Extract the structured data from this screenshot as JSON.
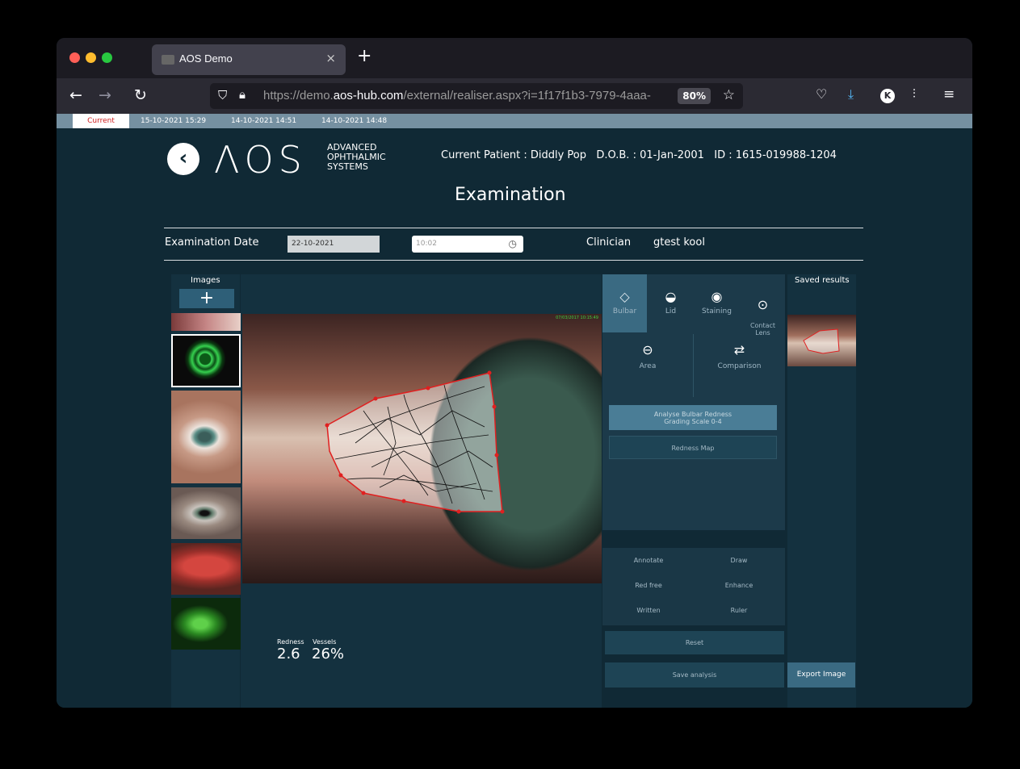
{
  "browser": {
    "tab_title": "AOS Demo",
    "url_dim_prefix": "https://demo.",
    "url_domain": "aos-hub.com",
    "url_path": "/external/realiser.aspx?i=1f17f1b3-7979-4aaa-",
    "zoom": "80%",
    "account_initial": "K"
  },
  "history_tabs": [
    "Current",
    "15-10-2021 15:29",
    "14-10-2021 14:51",
    "14-10-2021 14:48"
  ],
  "brand": {
    "name": "ΛOS",
    "sub_lines": [
      "ADVANCED",
      "OPHTHALMIC",
      "SYSTEMS"
    ]
  },
  "patient": {
    "header": "Current Patient : Diddly Pop   D.O.B. : 01-Jan-2001   ID : 1615-019988-1204"
  },
  "page_title": "Examination",
  "exam": {
    "date_label": "Examination Date",
    "date_value": "22-10-2021",
    "time_value": "10:02",
    "clinician_label": "Clinician",
    "clinician_value": "gtest kool"
  },
  "images_panel": {
    "label": "Images",
    "add": "+"
  },
  "analysis_tabs": [
    "Bulbar",
    "Lid",
    "Staining",
    "Contact\nLens"
  ],
  "analysis_modes": [
    "Area",
    "Comparison"
  ],
  "analysis_buttons": {
    "primary_line1": "Analyse Bulbar Redness",
    "primary_line2": "Grading Scale 0-4",
    "redness_map": "Redness Map"
  },
  "tools": [
    "Annotate",
    "Draw",
    "Red free",
    "Enhance",
    "Written",
    "Ruler"
  ],
  "reset": "Reset",
  "save_analysis": "Save analysis",
  "export_image": "Export Image",
  "saved_results_label": "Saved results",
  "metrics": {
    "redness_label": "Redness",
    "vessels_label": "Vessels",
    "redness_value": "2.6",
    "vessels_value": "26%"
  },
  "image_stamp": "07/03/2017 10:15:49",
  "colors": {
    "background": "#102935",
    "panel": "#1c3a4a",
    "active_tab": "#3a6a82",
    "accent_button": "#4a7d96",
    "roi": "#e02020"
  }
}
